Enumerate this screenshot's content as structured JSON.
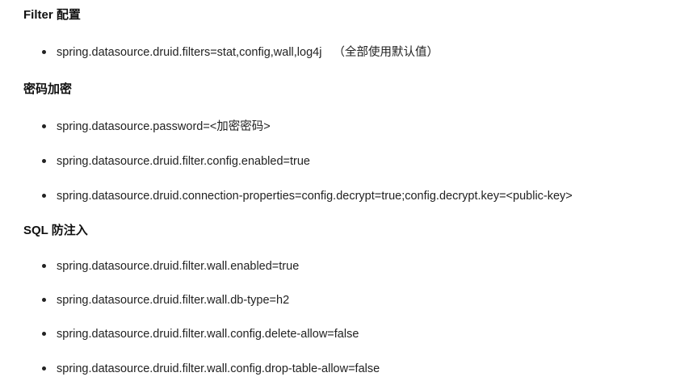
{
  "sections": [
    {
      "heading": "Filter 配置",
      "items": [
        {
          "text": "spring.datasource.druid.filters=stat,config,wall,log4j",
          "note": "（全部使用默认值）"
        }
      ]
    },
    {
      "heading": "密码加密",
      "items": [
        {
          "text": "spring.datasource.password=<加密密码>"
        },
        {
          "text": "spring.datasource.druid.filter.config.enabled=true"
        },
        {
          "text": "spring.datasource.druid.connection-properties=config.decrypt=true;config.decrypt.key=<public-key>"
        }
      ]
    },
    {
      "heading": "SQL 防注入",
      "items": [
        {
          "text": "spring.datasource.druid.filter.wall.enabled=true"
        },
        {
          "text": "spring.datasource.druid.filter.wall.db-type=h2"
        },
        {
          "text": "spring.datasource.druid.filter.wall.config.delete-allow=false"
        },
        {
          "text": "spring.datasource.druid.filter.wall.config.drop-table-allow=false"
        }
      ]
    }
  ]
}
